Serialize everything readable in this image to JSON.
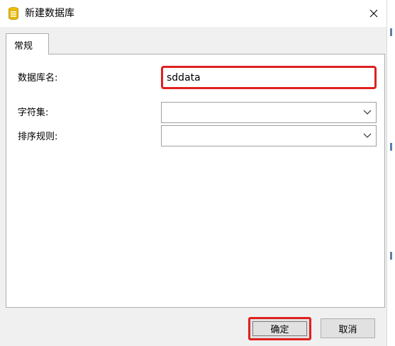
{
  "window": {
    "title": "新建数据库",
    "close_icon": "close-icon",
    "app_icon": "database-icon"
  },
  "tabs": [
    {
      "label": "常规",
      "active": true
    }
  ],
  "form": {
    "db_name_label": "数据库名:",
    "db_name_value": "sddata",
    "charset_label": "字符集:",
    "charset_value": "",
    "collation_label": "排序规则:",
    "collation_value": ""
  },
  "buttons": {
    "ok_label": "确定",
    "cancel_label": "取消"
  },
  "colors": {
    "highlight": "#e02020",
    "app_icon": "#e8b800"
  }
}
